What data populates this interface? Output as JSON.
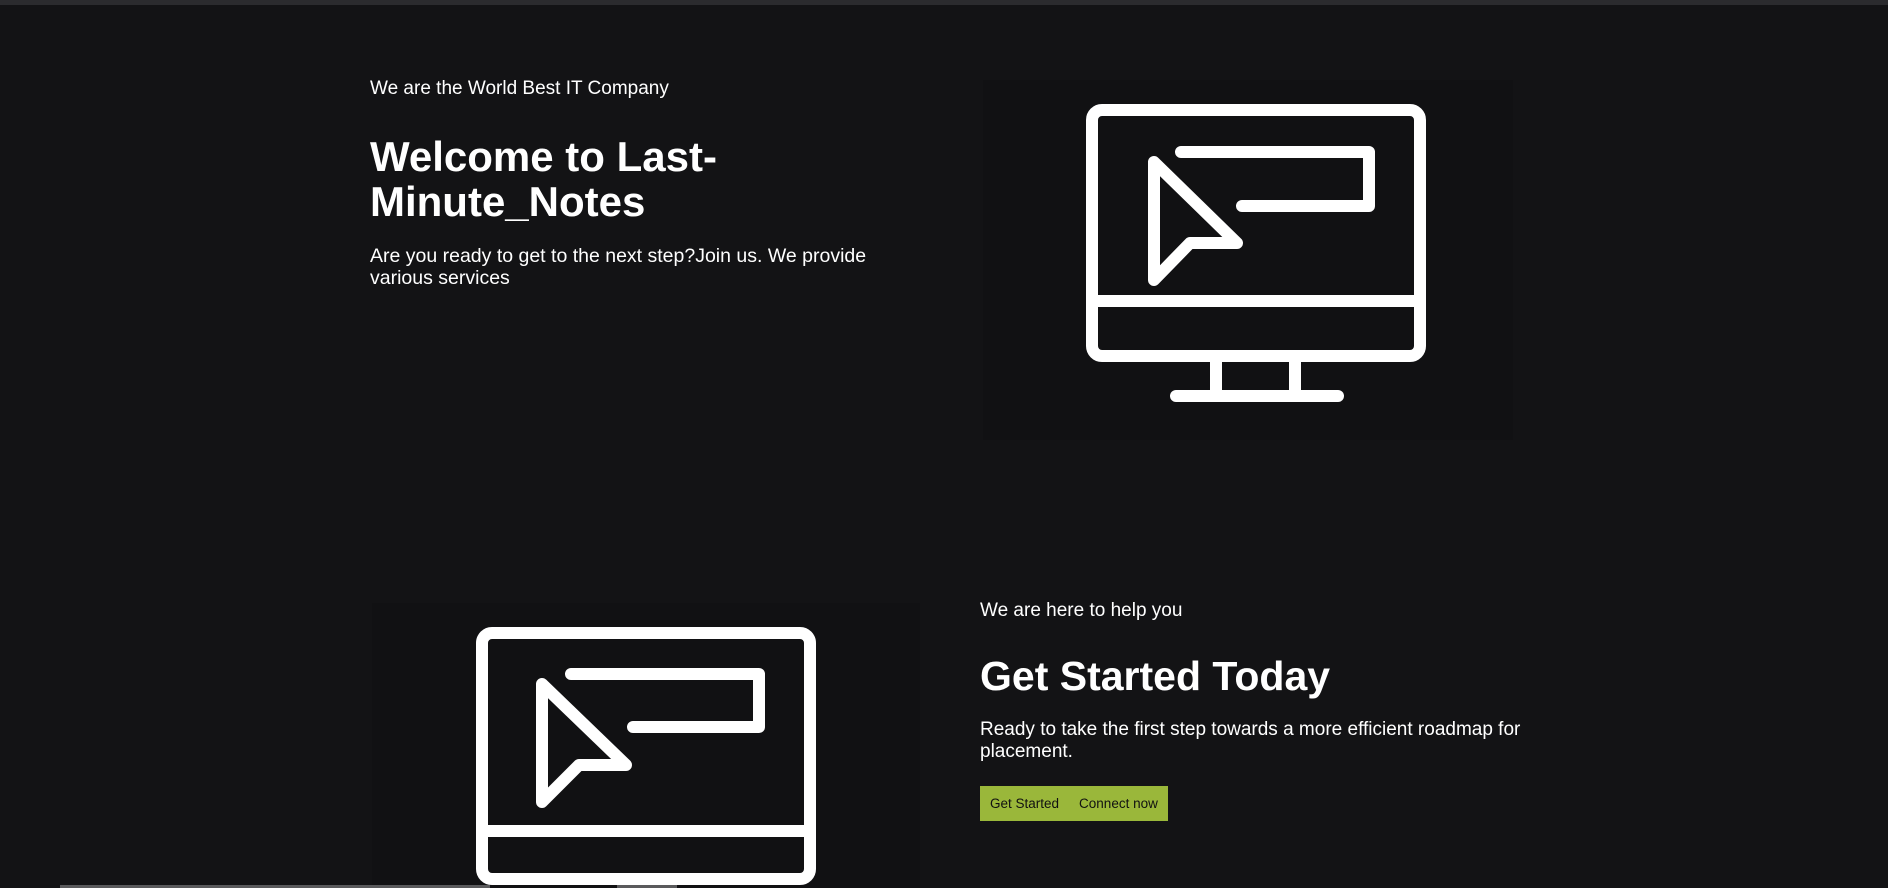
{
  "hero": {
    "tagline": "We are the World Best IT Company",
    "title": "Welcome to Last-Minute_Notes",
    "description": "Are you ready to get to the next step?Join us. We provide various services",
    "illustration": "monitor-cursor-icon"
  },
  "cta": {
    "eyebrow": "We are here to help you",
    "title": "Get Started Today",
    "description": "Ready to take the first step towards a more efficient roadmap for placement.",
    "illustration": "monitor-cursor-icon",
    "buttons": {
      "get_started": "Get Started",
      "connect_now": "Connect now"
    }
  },
  "colors": {
    "background": "#131315",
    "accent": "#9ab73a",
    "text": "#ffffff"
  }
}
